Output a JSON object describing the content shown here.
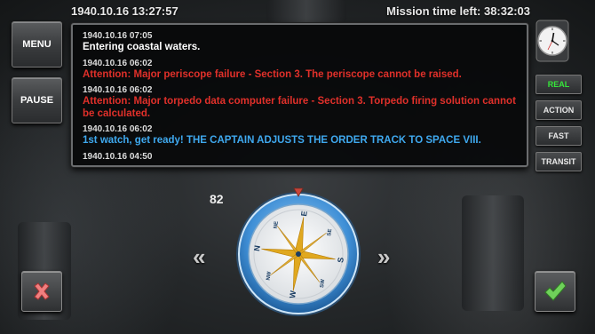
{
  "header": {
    "datetime": "1940.10.16 13:27:57",
    "mission_time": "Mission time left: 38:32:03"
  },
  "left_buttons": {
    "menu": "MENU",
    "pause": "PAUSE"
  },
  "log": [
    {
      "time": "1940.10.16 07:05",
      "message": "Entering coastal waters.",
      "color": "#ffffff"
    },
    {
      "time": "1940.10.16 06:02",
      "message": "Attention: Major periscope failure - Section 3. The periscope cannot be raised.",
      "color": "#e0302a"
    },
    {
      "time": "1940.10.16 06:02",
      "message": "Attention: Major torpedo data computer failure - Section 3. Torpedo firing solution cannot be calculated.",
      "color": "#e0302a"
    },
    {
      "time": "1940.10.16 06:02",
      "message": "1st watch, get ready! THE CAPTAIN ADJUSTS THE ORDER TRACK TO SPACE VIII.",
      "color": "#3fa9ef"
    },
    {
      "time": "1940.10.16 04:50",
      "message": "",
      "color": "#ffffff"
    }
  ],
  "time_compression": {
    "active": "REAL",
    "options": [
      "REAL",
      "ACTION",
      "FAST",
      "TRANSIT"
    ],
    "active_color": "#35e53a"
  },
  "compass": {
    "heading": "82",
    "cardinals": {
      "n": "N",
      "e": "E",
      "s": "S",
      "w": "W"
    },
    "intercardinals": {
      "ne": "NE",
      "se": "SE",
      "sw": "SW",
      "nw": "NW"
    }
  },
  "icons": {
    "prev": "chevron-double-left-icon",
    "next": "chevron-double-right-icon",
    "cancel": "x-icon",
    "confirm": "checkmark-icon",
    "clock": "clock-icon"
  },
  "nav_arrows": {
    "prev": "«",
    "next": "»"
  }
}
